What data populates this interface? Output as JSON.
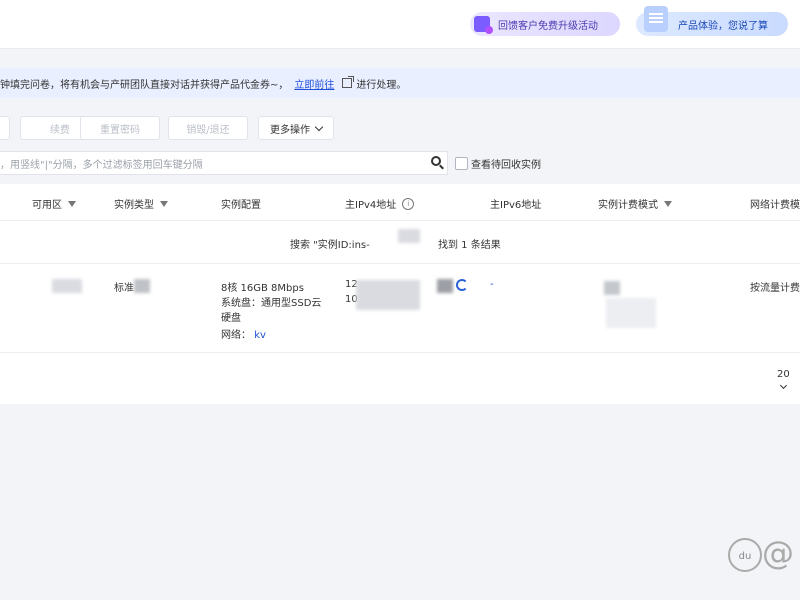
{
  "header": {
    "promo_feedback": "回馈客户免费升级活动",
    "promo_experience": "产品体验，您说了算"
  },
  "notice": {
    "text": "钟填完问卷，将有机会与产研团队直接对话并获得产品代金券~，",
    "link": "立即前往",
    "suffix": "进行处理。"
  },
  "toolbar": {
    "btn_partial": "",
    "btn_renew": "续费",
    "btn_reset_password": "重置密码",
    "btn_destroy": "销毁/退还",
    "btn_more": "更多操作"
  },
  "search": {
    "placeholder": "，用竖线\"|\"分隔，多个过滤标签用回车键分隔",
    "recycle_label": "查看待回收实例"
  },
  "table": {
    "headers": {
      "zone": "可用区",
      "type": "实例类型",
      "config": "实例配置",
      "ipv4": "主IPv4地址",
      "ipv6": "主IPv6地址",
      "billing": "实例计费模式",
      "network_billing": "网络计费模"
    },
    "search_result_prefix": "搜索 \"实例ID:ins-",
    "search_result_suffix": "找到 1 条结果",
    "rows": [
      {
        "type": "标准",
        "config_line1": "8核 16GB 8Mbps",
        "config_line2": "系统盘：通用型SSD云",
        "config_line3": "硬盘",
        "network_label": "网络：",
        "network_value": "kv",
        "ipv4_a": "12",
        "ipv4_b": "10",
        "ipv6": "-",
        "network_billing": "按流量计费"
      }
    ],
    "page_size": "20"
  }
}
